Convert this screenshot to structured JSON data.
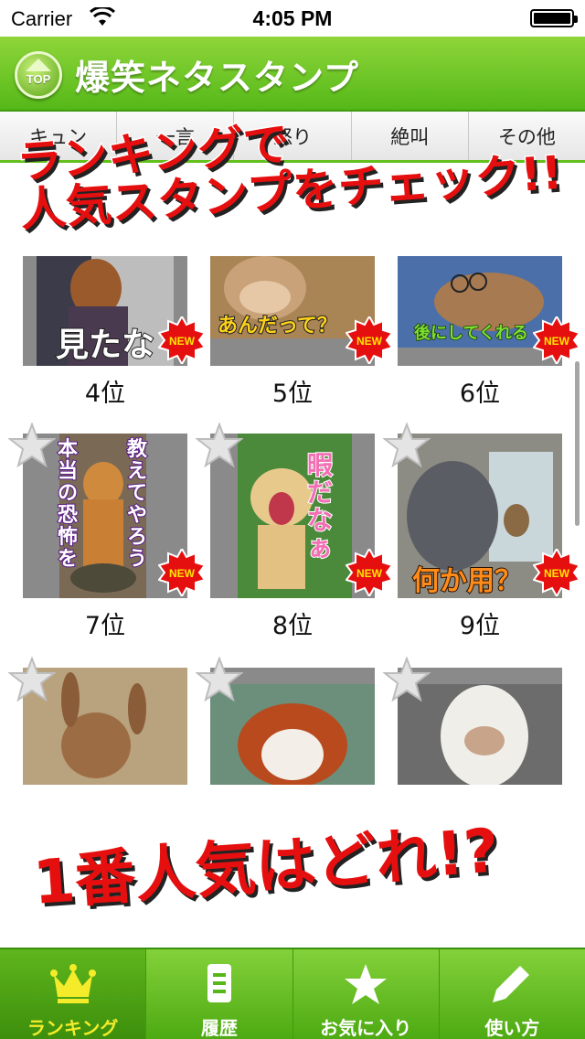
{
  "status_bar": {
    "carrier": "Carrier",
    "time": "4:05 PM"
  },
  "header": {
    "top_button_label": "TOP",
    "title": "爆笑ネタスタンプ"
  },
  "category_tabs": [
    {
      "label": "キュン"
    },
    {
      "label": "一言"
    },
    {
      "label": "怒り"
    },
    {
      "label": "絶叫"
    },
    {
      "label": "その他"
    }
  ],
  "banners": {
    "line1": "ランキングで",
    "line2": "人気スタンプをチェック!!",
    "bottom": "1番人気はどれ!?"
  },
  "colors": {
    "header_green": "#55b818",
    "active_tab_yellow": "#f4ec2a",
    "banner_red": "#e60f0f"
  },
  "items": [
    {
      "rank": "4位",
      "caption": "見たな",
      "badge": "NEW",
      "starred": false
    },
    {
      "rank": "5位",
      "caption": "あんだって？",
      "badge": "NEW",
      "starred": false
    },
    {
      "rank": "6位",
      "caption": "後にしてくれる",
      "badge": "NEW",
      "starred": false
    },
    {
      "rank": "7位",
      "caption": "教えてやろう 本当の恐怖を",
      "badge": "NEW",
      "starred": false
    },
    {
      "rank": "8位",
      "caption": "暇だなぁ",
      "badge": "NEW",
      "starred": false
    },
    {
      "rank": "9位",
      "caption": "何か用？",
      "badge": "NEW",
      "starred": false
    },
    {
      "rank": "",
      "caption": "",
      "badge": "",
      "starred": false
    },
    {
      "rank": "",
      "caption": "",
      "badge": "",
      "starred": false
    },
    {
      "rank": "",
      "caption": "",
      "badge": "",
      "starred": false
    }
  ],
  "tab_bar": [
    {
      "label": "ランキング",
      "icon": "crown-icon",
      "active": true
    },
    {
      "label": "履歴",
      "icon": "document-icon",
      "active": false
    },
    {
      "label": "お気に入り",
      "icon": "star-icon",
      "active": false
    },
    {
      "label": "使い方",
      "icon": "pencil-icon",
      "active": false
    }
  ]
}
